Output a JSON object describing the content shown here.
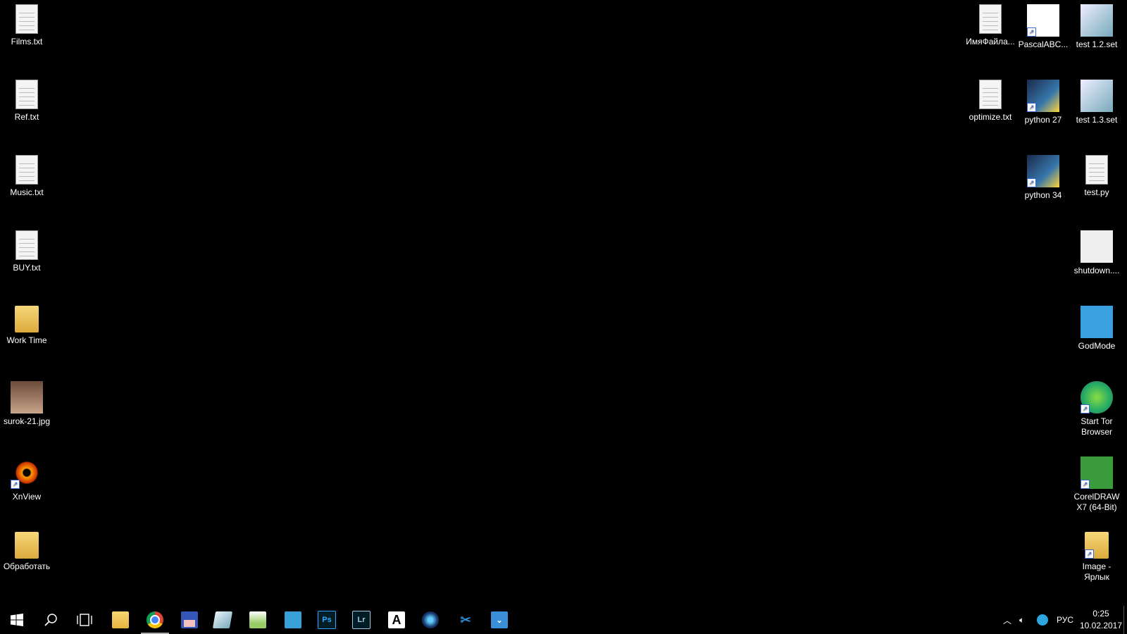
{
  "desktop_left": [
    {
      "label": "Films.txt",
      "icon": "text-file-icon"
    },
    {
      "label": "Ref.txt",
      "icon": "text-file-icon"
    },
    {
      "label": "Music.txt",
      "icon": "text-file-icon"
    },
    {
      "label": "BUY.txt",
      "icon": "text-file-icon"
    },
    {
      "label": "Work Time",
      "icon": "folder-icon"
    },
    {
      "label": "surok-21.jpg",
      "icon": "image-file-icon"
    },
    {
      "label": "XnView",
      "icon": "xnview-icon"
    },
    {
      "label": "Обработать",
      "icon": "folder-icon"
    }
  ],
  "desktop_right": [
    {
      "label": "ИмяФайла...",
      "icon": "script-file-icon"
    },
    {
      "label": "PascalABC...",
      "icon": "pascalabc-icon"
    },
    {
      "label": "test 1.2.set",
      "icon": "set-file-icon"
    },
    {
      "label": "optimize.txt",
      "icon": "text-file-icon"
    },
    {
      "label": "python 27",
      "icon": "python-icon"
    },
    {
      "label": "test 1.3.set",
      "icon": "set-file-icon"
    },
    {
      "label": "python 34",
      "icon": "python-icon"
    },
    {
      "label": "test.py",
      "icon": "python-file-icon"
    },
    {
      "label": "shutdown....",
      "icon": "settings-file-icon"
    },
    {
      "label": "GodMode",
      "icon": "control-panel-icon"
    },
    {
      "label": "Start Tor Browser",
      "icon": "tor-browser-icon"
    },
    {
      "label": "CorelDRAW X7 (64-Bit)",
      "icon": "coreldraw-icon"
    },
    {
      "label": "Image - Ярлык",
      "icon": "folder-shortcut-icon"
    }
  ],
  "taskbar": {
    "apps": [
      "start",
      "search",
      "task-view",
      "file-explorer",
      "chrome",
      "save-app",
      "notepad",
      "notepad-plus",
      "text-ru",
      "photoshop",
      "lightroom",
      "font-app",
      "camera-app",
      "snipping-tool",
      "pocket"
    ],
    "ps_label": "Ps",
    "lr_label": "Lr",
    "font_label": "A",
    "tray": {
      "lang": "РУС",
      "time": "0:25",
      "date": "10.02.2017"
    }
  }
}
